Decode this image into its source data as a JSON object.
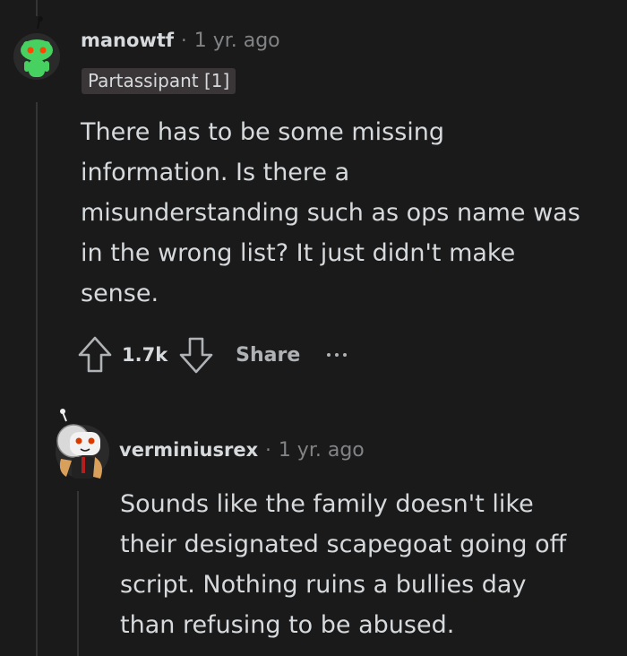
{
  "comment": {
    "username": "manowtf",
    "separator": "·",
    "age": "1 yr. ago",
    "flair": "Partassipant [1]",
    "body": [
      "There has to be some missing",
      "information. Is there a",
      "misunderstanding such as ops name was",
      "in the wrong list? It just didn't make",
      "sense."
    ],
    "actions": {
      "upvote_icon": "arrow-up-icon",
      "vote_count": "1.7k",
      "downvote_icon": "arrow-down-icon",
      "share_label": "Share",
      "more_icon": "ellipsis-icon"
    },
    "avatar_icon": "snoo-avatar-icon"
  },
  "reply": {
    "username": "verminiusrex",
    "separator": "·",
    "age": "1 yr. ago",
    "body": [
      "Sounds like the family doesn't like",
      "their designated scapegoat going off",
      "script. Nothing ruins a bullies day",
      "than refusing to be abused."
    ],
    "avatar_icon": "astronaut-avatar-icon"
  },
  "colors": {
    "background": "#1a1a1b",
    "text": "#d7dadc",
    "meta": "#818384",
    "thread_line": "#343536",
    "flair_bg": "#3a3536",
    "snoo_green": "#46d160"
  }
}
